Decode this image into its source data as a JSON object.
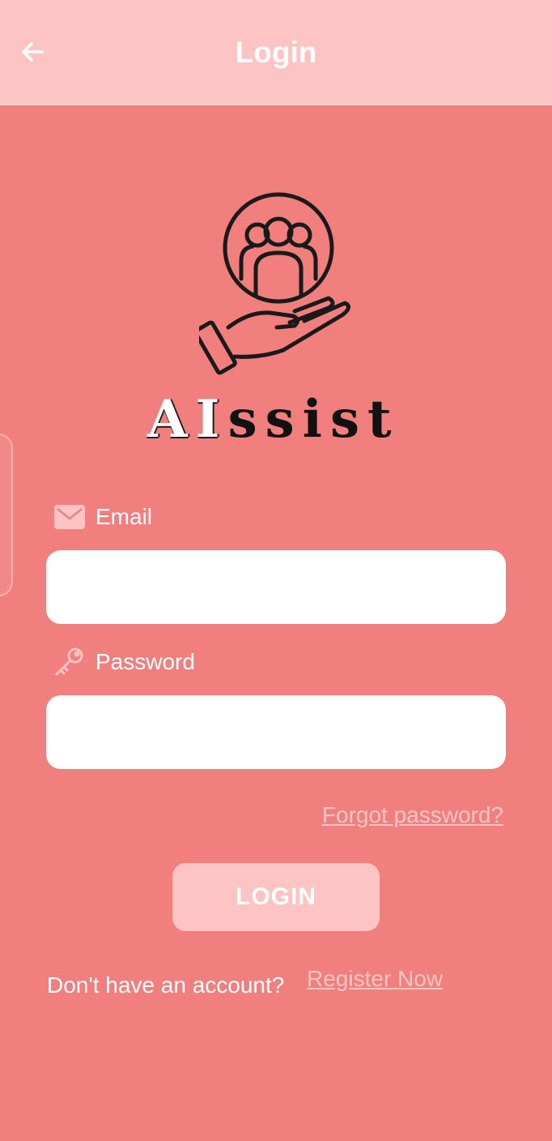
{
  "appbar": {
    "title": "Login",
    "back_icon": "arrow-left-icon"
  },
  "logo": {
    "wordmark_ai": "AI",
    "wordmark_rest": "ssist",
    "icon": "hand-holding-people-icon"
  },
  "form": {
    "email": {
      "label": "Email",
      "icon": "envelope-icon",
      "value": "",
      "placeholder": ""
    },
    "password": {
      "label": "Password",
      "icon": "key-icon",
      "value": "",
      "placeholder": ""
    },
    "forgot_link": "Forgot password?",
    "login_button": "LOGIN"
  },
  "footer": {
    "prompt": "Don't have an account?",
    "register_link": "Register Now"
  },
  "colors": {
    "background": "#F07F7E",
    "appbar": "#FEC4C4",
    "button": "#FEC4C4",
    "link": "#FCC5C5",
    "input": "#FFFFFF",
    "text": "#FFFFFF"
  }
}
